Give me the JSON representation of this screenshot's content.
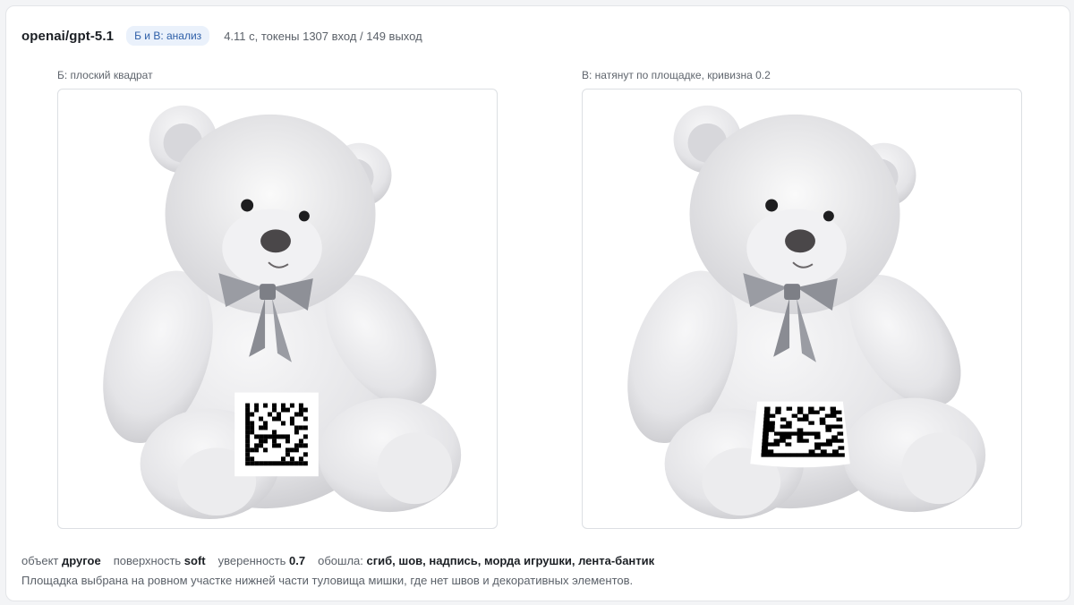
{
  "header": {
    "model": "openai/gpt-5.1",
    "badge": "Б и В: анализ",
    "meta": "4.11 с, токены 1307 вход / 149 выход"
  },
  "panels": [
    {
      "caption": "Б: плоский квадрат",
      "variant": "flat"
    },
    {
      "caption": "В: натянут по площадке, кривизна 0.2",
      "variant": "curved"
    }
  ],
  "stats": {
    "object_label": "объект",
    "object_value": "другое",
    "surface_label": "поверхность",
    "surface_value": "soft",
    "confidence_label": "уверенность",
    "confidence_value": "0.7",
    "avoided_label": "обошла:",
    "avoided_value": "сгиб, шов, надпись, морда игрушки, лента-бантик"
  },
  "note": "Площадка выбрана на ровном участке нижней части туловища мишки, где нет швов и декоративных элементов.",
  "colors": {
    "badge_bg": "#eaf1fb",
    "badge_text": "#2e5fa8",
    "bow": "#9a9ca3"
  }
}
